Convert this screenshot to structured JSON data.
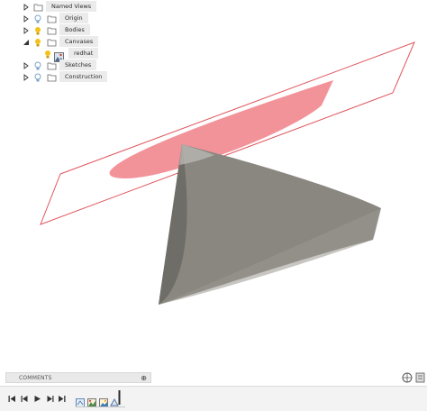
{
  "browser": {
    "items": [
      {
        "label": "Named Views",
        "icon": "folder-icon"
      },
      {
        "label": "Origin",
        "icon": "folder-icon",
        "visibility": "light-bulb-off-icon"
      },
      {
        "label": "Bodies",
        "icon": "folder-icon",
        "visibility": "light-bulb-on-icon"
      },
      {
        "label": "Canvases",
        "icon": "folder-icon",
        "visibility": "light-bulb-on-icon"
      },
      {
        "label": "Sketches",
        "icon": "folder-icon",
        "visibility": "light-bulb-off-icon"
      },
      {
        "label": "Construction",
        "icon": "folder-icon",
        "visibility": "light-bulb-off-icon"
      }
    ],
    "canvas_child": {
      "label": "redhat",
      "icon": "canvas-image-icon",
      "visibility": "light-bulb-on-icon"
    }
  },
  "comments": {
    "title": "COMMENTS",
    "add_symbol": "⊕"
  },
  "colors": {
    "bulb_on": "#f2c21b",
    "bulb_off": "#7aa3c9",
    "canvas_plane_outline": "#e0555d",
    "canvas_image_fill": "#f08088",
    "cone_face": "#8a8780",
    "cone_side": "#6f6d67",
    "cone_base": "#9a978f",
    "panel_bg": "#ebebeb"
  },
  "timeline": {
    "controls": [
      "skip-to-start-icon",
      "step-back-icon",
      "play-icon",
      "step-forward-icon",
      "skip-to-end-icon"
    ],
    "features": [
      "sketch-feature-icon",
      "canvas-feature-icon",
      "image-feature-icon",
      "body-feature-icon"
    ]
  }
}
